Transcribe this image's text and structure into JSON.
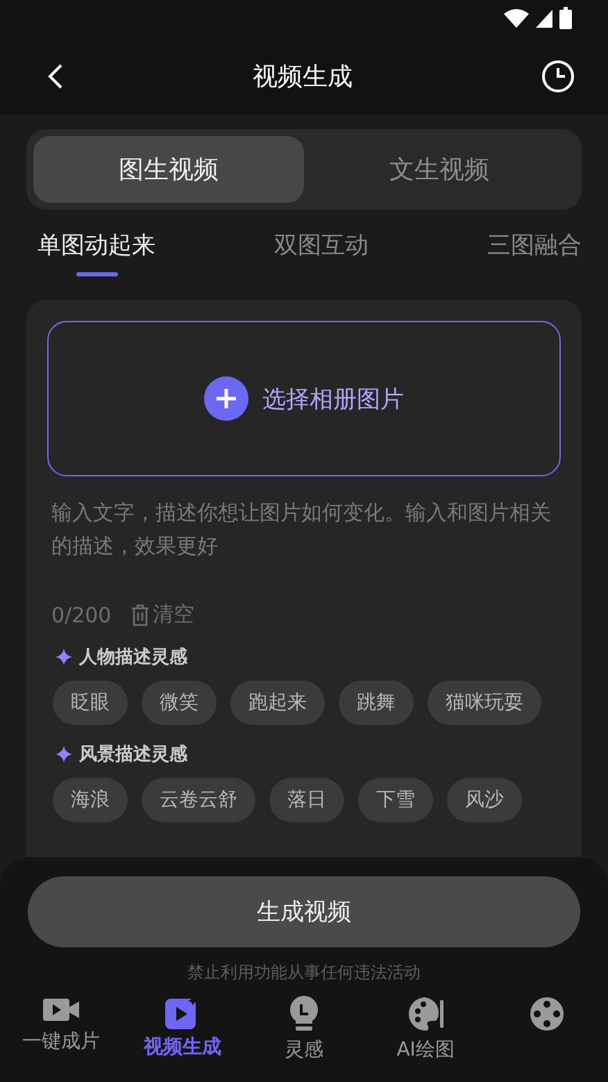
{
  "header": {
    "title": "视频生成"
  },
  "modes": [
    {
      "label": "图生视频",
      "selected": true
    },
    {
      "label": "文生视频",
      "selected": false
    }
  ],
  "subtabs": [
    {
      "label": "单图动起来",
      "selected": true
    },
    {
      "label": "双图互动",
      "selected": false
    },
    {
      "label": "三图融合",
      "selected": false
    }
  ],
  "upload": {
    "label": "选择相册图片"
  },
  "prompt": {
    "placeholder": "输入文字，描述你想让图片如何变化。输入和图片相关的描述，效果更好",
    "counter": "0/200",
    "clear": "清空"
  },
  "inspirations": [
    {
      "title": "人物描述灵感",
      "chips": [
        "眨眼",
        "微笑",
        "跑起来",
        "跳舞",
        "猫咪玩耍"
      ]
    },
    {
      "title": "风景描述灵感",
      "chips": [
        "海浪",
        "云卷云舒",
        "落日",
        "下雪",
        "风沙"
      ]
    }
  ],
  "generate_button": "生成视频",
  "disclaimer": "禁止利用功能从事任何违法活动",
  "nav": [
    {
      "kind": "camera",
      "label": "一键成片",
      "selected": false
    },
    {
      "kind": "video",
      "label": "视频生成",
      "selected": true
    },
    {
      "kind": "bulb",
      "label": "灵感",
      "selected": false
    },
    {
      "kind": "palette",
      "label": "AI绘图",
      "selected": false
    },
    {
      "kind": "reel",
      "selected": false
    }
  ]
}
